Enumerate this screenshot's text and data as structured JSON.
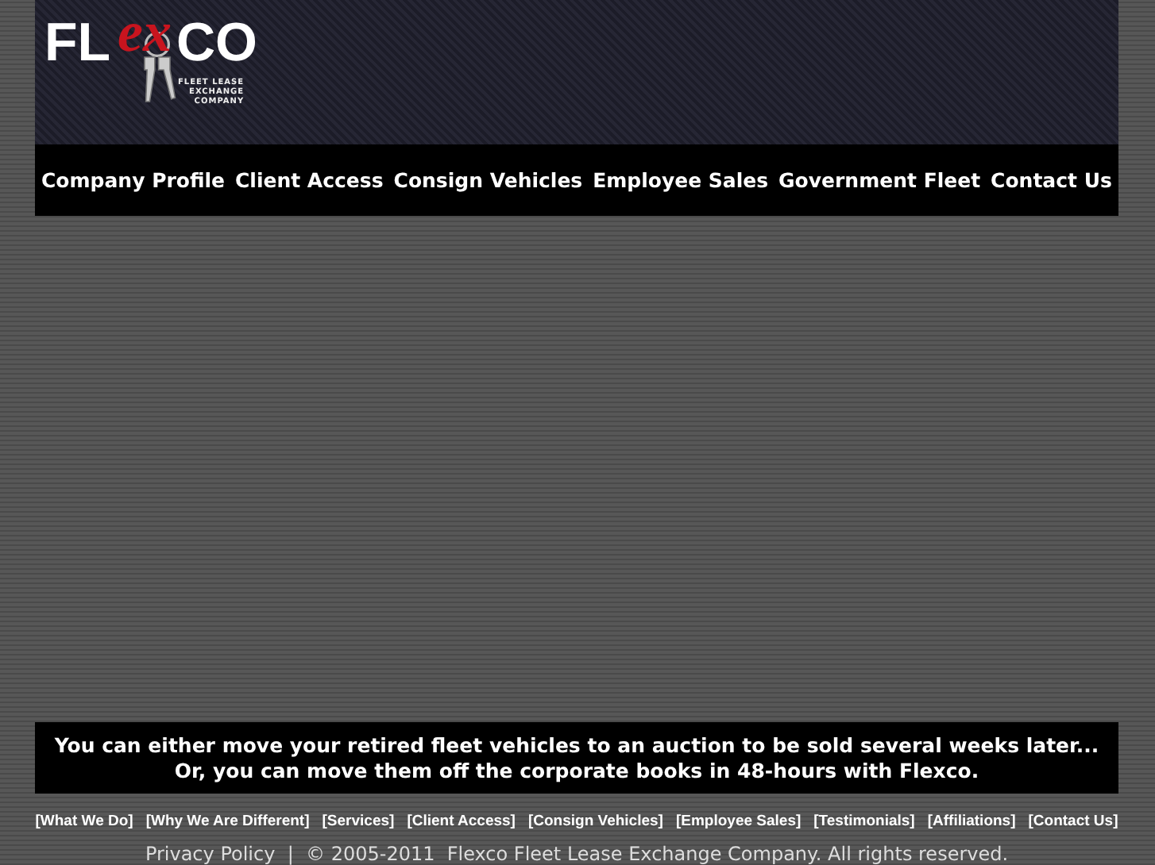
{
  "logo": {
    "left": "FL",
    "middle": "ex",
    "right": "CO",
    "tagline": [
      "FLEET LEASE",
      "EXCHANGE",
      "COMPANY"
    ]
  },
  "nav": [
    "Company Profile",
    "Client Access",
    "Consign Vehicles",
    "Employee Sales",
    "Government Fleet",
    "Contact Us"
  ],
  "banner": [
    "You can either move your retired fleet vehicles to an auction to be sold several weeks later...",
    "Or, you can move them off the corporate books in 48-hours with Flexco."
  ],
  "footer_links": [
    "[What We Do]",
    "[Why We Are Different]",
    "[Services]",
    "[Client Access]",
    "[Consign Vehicles]",
    "[Employee Sales]",
    "[Testimonials]",
    "[Affiliations]",
    "[Contact Us]"
  ],
  "copyright": "Privacy Policy  |  © 2005-2011  Flexco Fleet Lease Exchange Company. All rights reserved."
}
